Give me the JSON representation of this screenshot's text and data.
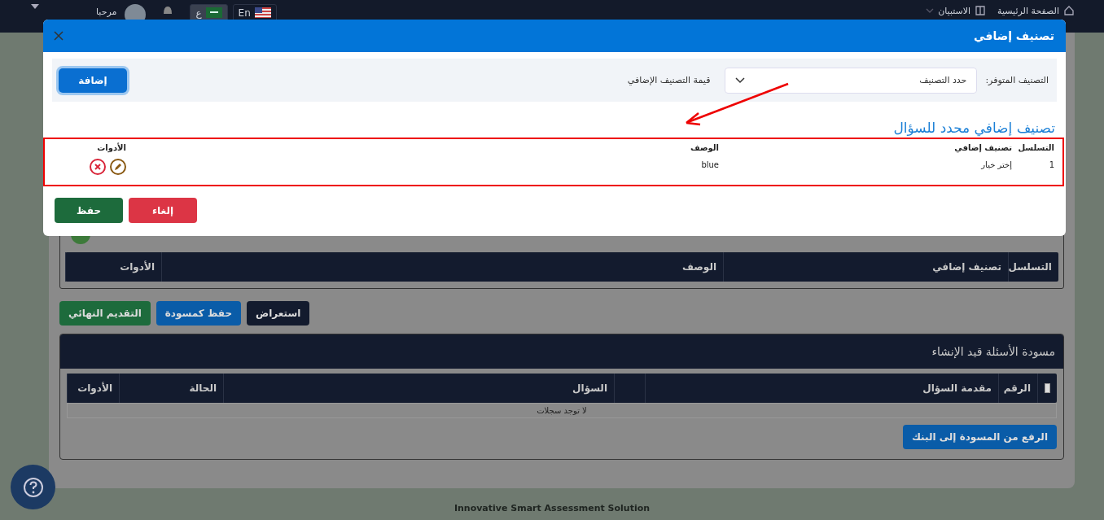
{
  "topbar": {
    "nav": [
      {
        "label": "الصفحة الرئيسية",
        "dropdown": false
      },
      {
        "label": "الاستبيان",
        "dropdown": true
      }
    ],
    "languages": [
      {
        "label": "En",
        "selected": false
      },
      {
        "label": "ع",
        "selected": true
      }
    ],
    "greeting": "مرحبا"
  },
  "page": {
    "classification_table": {
      "columns": [
        "التسلسل",
        "تصنيف إضافي",
        "الوصف",
        "الأدوات"
      ]
    },
    "actions": [
      {
        "label": "استعراض",
        "kind": "dark"
      },
      {
        "label": "حفظ كمسودة",
        "kind": "primary"
      },
      {
        "label": "التقديم النهائي",
        "kind": "success"
      }
    ],
    "drafts": {
      "title": "مسودة الأسئلة قيد الإنشاء",
      "select_all": {
        "checked": false
      },
      "columns": [
        "الرقم",
        "مقدمة السؤال",
        "",
        "السؤال",
        "الحالة",
        "الأدوات"
      ],
      "empty": "لا توجد سجلات",
      "upload_button": "الرفع من المسودة إلى البنك"
    }
  },
  "footer": "Innovative Smart Assessment Solution",
  "dialog": {
    "title": "تصنيف إضافي",
    "form": {
      "available_label": "التصنيف المتوفر:",
      "select_placeholder": "حدد التصنيف",
      "value_label": "قيمة التصنيف الإضافي",
      "add_button": "إضافة"
    },
    "section_title": "تصنيف إضافي محدد للسؤال",
    "table": {
      "columns": [
        "التسلسل",
        "تصنيف إضافي",
        "الوصف",
        "الأدوات"
      ],
      "rows": [
        {
          "sequence": "1",
          "classification": "إختر خيار",
          "description": "blue"
        }
      ]
    },
    "buttons": [
      {
        "label": "إلغاء",
        "kind": "danger"
      },
      {
        "label": "حفظ",
        "kind": "success"
      }
    ]
  }
}
